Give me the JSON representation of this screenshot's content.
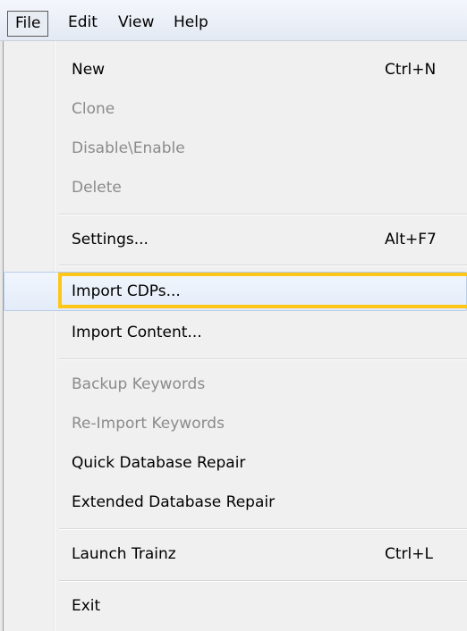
{
  "menubar": {
    "items": [
      {
        "label": "File",
        "active": true
      },
      {
        "label": "Edit"
      },
      {
        "label": "View"
      },
      {
        "label": "Help"
      }
    ]
  },
  "menu": {
    "items": [
      {
        "label": "New",
        "shortcut": "Ctrl+N",
        "enabled": true
      },
      {
        "label": "Clone",
        "enabled": false
      },
      {
        "label": "Disable\\Enable",
        "enabled": false
      },
      {
        "label": "Delete",
        "enabled": false
      },
      {
        "label": "Settings...",
        "shortcut": "Alt+F7",
        "enabled": true
      },
      {
        "label": "Import CDPs...",
        "enabled": true,
        "highlighted": true
      },
      {
        "label": "Import Content...",
        "enabled": true
      },
      {
        "label": "Backup Keywords",
        "enabled": false
      },
      {
        "label": "Re-Import Keywords",
        "enabled": false
      },
      {
        "label": "Quick Database Repair",
        "enabled": true
      },
      {
        "label": "Extended Database Repair",
        "enabled": true
      },
      {
        "label": "Launch Trainz",
        "shortcut": "Ctrl+L",
        "enabled": true
      },
      {
        "label": "Exit",
        "enabled": true
      }
    ]
  },
  "colors": {
    "highlight_border": "#ffc61a",
    "disabled_text": "#8b8b8b",
    "menu_background": "#f0f0f0"
  }
}
